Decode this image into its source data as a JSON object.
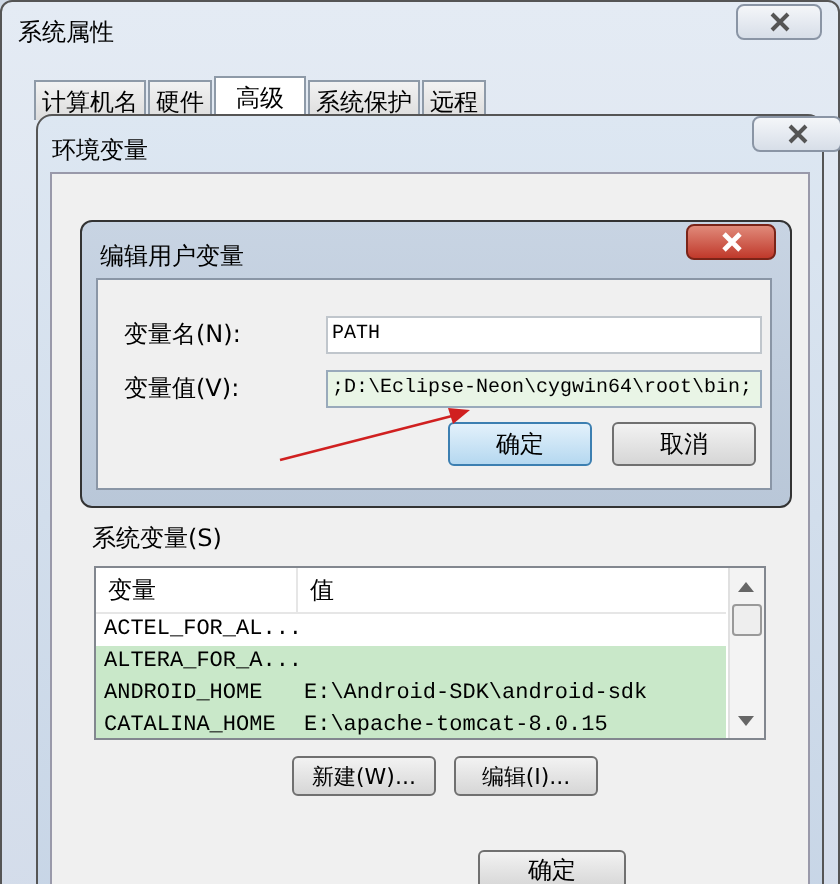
{
  "window": {
    "title": "系统属性"
  },
  "tabs": [
    {
      "label": "计算机名",
      "selected": false
    },
    {
      "label": "硬件",
      "selected": false
    },
    {
      "label": "高级",
      "selected": true
    },
    {
      "label": "系统保护",
      "selected": false
    },
    {
      "label": "远程",
      "selected": false
    }
  ],
  "env_dialog": {
    "title": "环境变量",
    "system_group": "系统变量(S)",
    "columns": [
      "变量",
      "值"
    ],
    "rows": [
      {
        "name": "ACTEL_FOR_AL...",
        "value": "",
        "selected": false
      },
      {
        "name": "ALTERA_FOR_A...",
        "value": "",
        "selected": true
      },
      {
        "name": "ANDROID_HOME",
        "value": "E:\\Android-SDK\\android-sdk",
        "selected": true
      },
      {
        "name": "CATALINA_HOME",
        "value": "E:\\apache-tomcat-8.0.15",
        "selected": true
      }
    ],
    "buttons": [
      "新建(W)...",
      "编辑(I)..."
    ],
    "ok": "确定"
  },
  "edit_dialog": {
    "title": "编辑用户变量",
    "fields": [
      {
        "label": "变量名(N):",
        "value": "PATH",
        "focused": false
      },
      {
        "label": "变量值(V):",
        "value": ";D:\\Eclipse-Neon\\cygwin64\\root\\bin;",
        "focused": true
      }
    ],
    "buttons": [
      {
        "label": "确定",
        "default": true
      },
      {
        "label": "取消",
        "default": false
      }
    ]
  }
}
